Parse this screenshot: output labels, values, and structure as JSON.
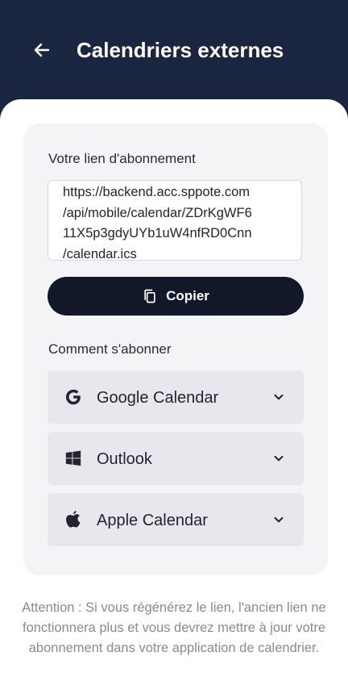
{
  "header": {
    "title": "Calendriers externes"
  },
  "subscription": {
    "label": "Votre lien d'abonnement",
    "link": "https://backend.acc.sppote.com\n/api/mobile/calendar/ZDrKgWF6\n11X5p3gdyUYb1uW4nfRD0Cnn\n/calendar.ics"
  },
  "copy_button": {
    "label": "Copier"
  },
  "how_to": {
    "label": "Comment s'abonner",
    "providers": [
      {
        "label": "Google Calendar",
        "icon": "google-icon"
      },
      {
        "label": "Outlook",
        "icon": "windows-icon"
      },
      {
        "label": "Apple Calendar",
        "icon": "apple-icon"
      }
    ]
  },
  "warning": "Attention : Si vous régénérez le lien, l'ancien lien ne fonctionnera plus et vous devrez mettre à jour votre abonnement dans votre application de calendrier.",
  "colors": {
    "header_bg": "#1a2540",
    "button_bg": "#12172a",
    "card_bg": "#f4f4f7",
    "provider_bg": "#e8e7ee"
  }
}
